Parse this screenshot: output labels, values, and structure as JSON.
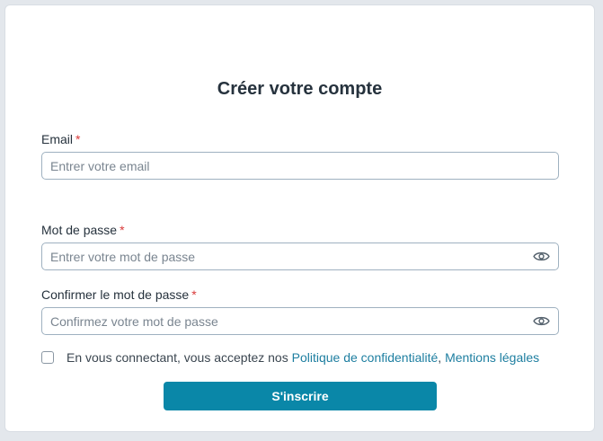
{
  "form": {
    "title": "Créer votre compte",
    "required_mark": "*",
    "email": {
      "label": "Email",
      "placeholder": "Entrer votre email",
      "value": ""
    },
    "password": {
      "label": "Mot de passe",
      "placeholder": "Entrer votre mot de passe",
      "value": ""
    },
    "confirm_password": {
      "label": "Confirmer le mot de passe",
      "placeholder": "Confirmez votre mot de passe",
      "value": ""
    },
    "terms": {
      "text": "En vous connectant, vous acceptez nos",
      "privacy_link": "Politique de confidentialité",
      "separator": ",",
      "legal_link": "Mentions légales",
      "checked": false
    },
    "submit_label": "S'inscrire"
  },
  "icons": {
    "password_toggle": "eye-icon",
    "confirm_toggle": "eye-icon"
  },
  "colors": {
    "primary": "#0a87a8",
    "link": "#1d7ea0",
    "required": "#d93a3a",
    "text": "#26323d",
    "border": "#9fb1c0"
  }
}
